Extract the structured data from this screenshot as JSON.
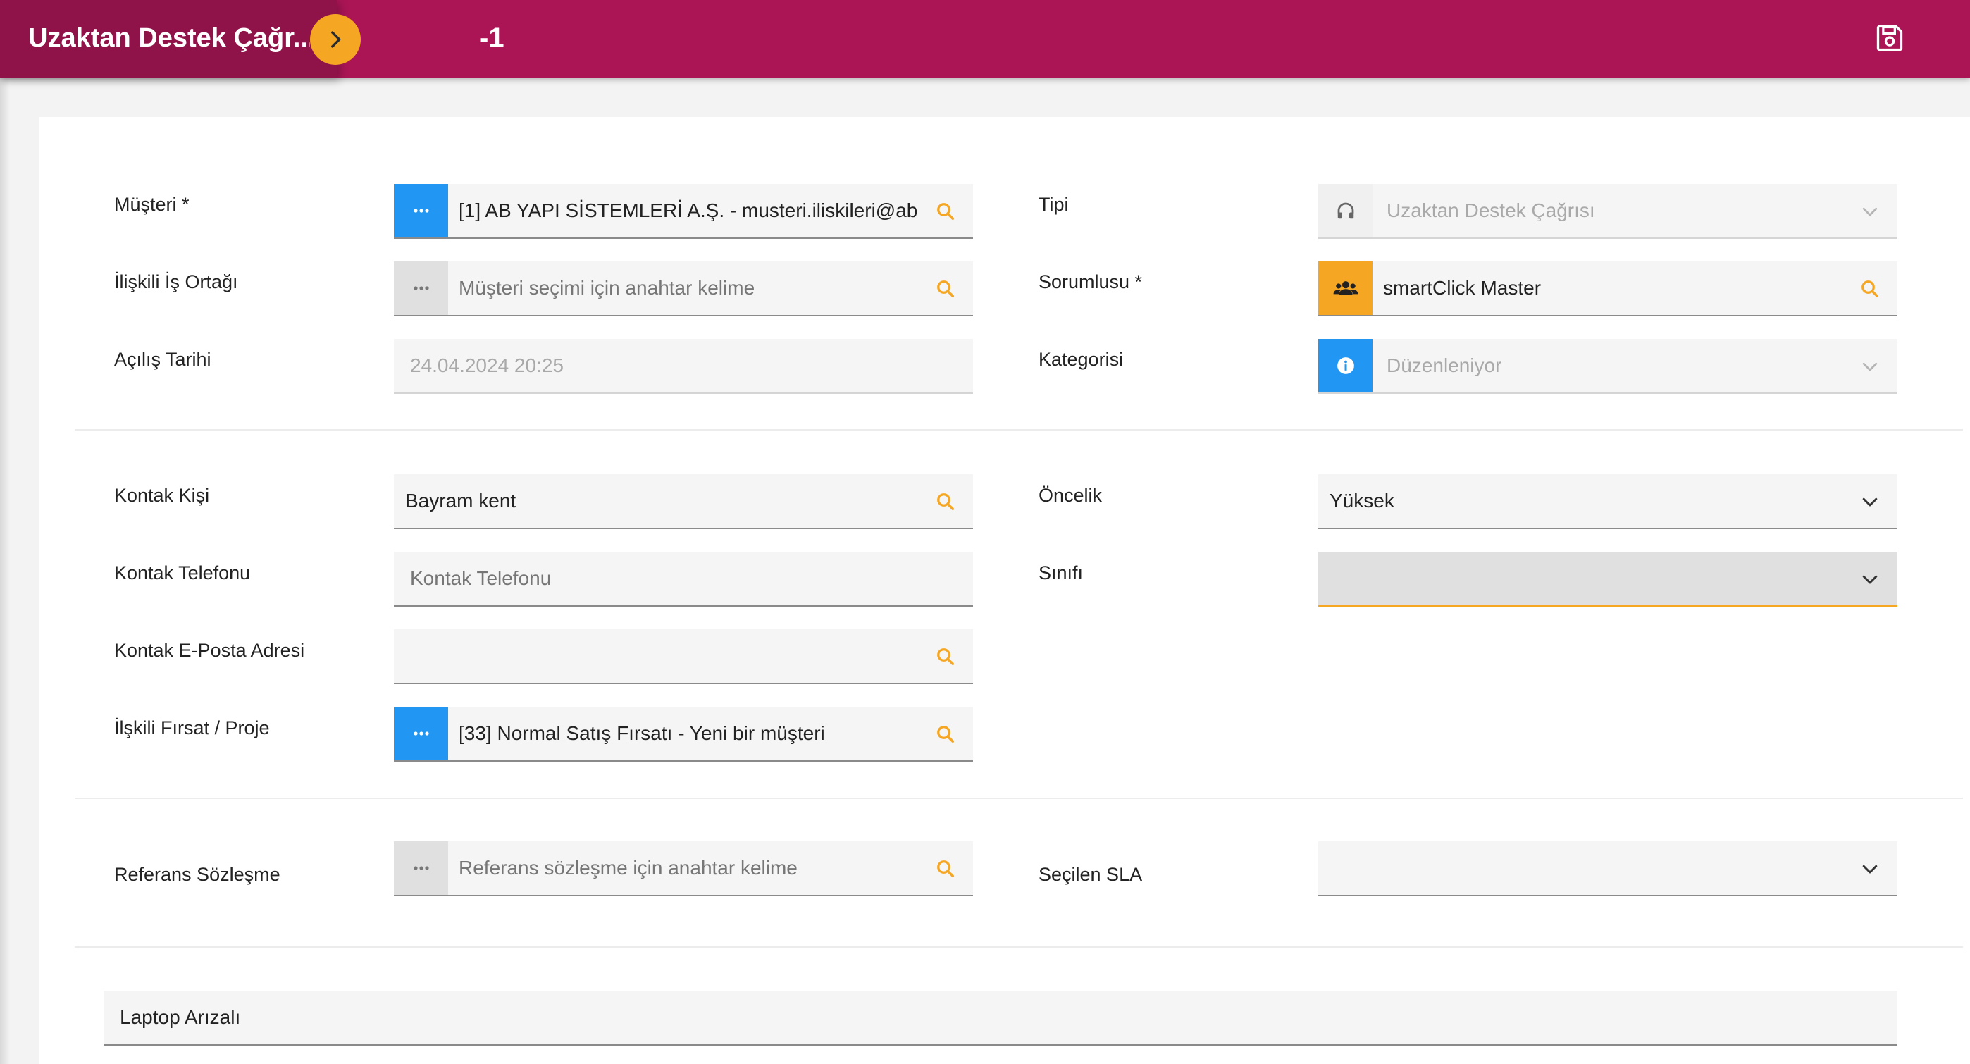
{
  "header": {
    "title": "Uzaktan Destek Çağr...",
    "record_id": "-1"
  },
  "form": {
    "musteri": {
      "label": "Müşteri  *",
      "value": "[1] AB YAPI SİSTEMLERİ A.Ş.  - musteri.iliskileri@ab"
    },
    "iliskili_is_ortagi": {
      "label": "İlişkili İş Ortağı",
      "placeholder": "Müşteri seçimi için anahtar kelime"
    },
    "acilis_tarihi": {
      "label": "Açılış Tarihi",
      "value": "24.04.2024 20:25"
    },
    "tipi": {
      "label": "Tipi",
      "value": "Uzaktan Destek Çağrısı"
    },
    "sorumlusu": {
      "label": "Sorumlusu  *",
      "value": "smartClick Master"
    },
    "kategorisi": {
      "label": "Kategorisi",
      "value": "Düzenleniyor"
    },
    "kontak_kisi": {
      "label": "Kontak Kişi",
      "value": "Bayram kent"
    },
    "kontak_telefonu": {
      "label": "Kontak Telefonu",
      "placeholder": "Kontak Telefonu"
    },
    "kontak_eposta": {
      "label": "Kontak E-Posta Adresi",
      "value": ""
    },
    "iliskili_firsat": {
      "label": "İlşkili Fırsat / Proje",
      "value": "[33] Normal Satış Fırsatı - Yeni bir müşteri"
    },
    "oncelik": {
      "label": "Öncelik",
      "value": "Yüksek"
    },
    "sinifi": {
      "label": "Sınıfı",
      "value": ""
    },
    "referans_sozlesme": {
      "label": "Referans Sözleşme",
      "placeholder": "Referans sözleşme için anahtar kelime"
    },
    "secilen_sla": {
      "label": "Seçilen SLA",
      "value": ""
    },
    "konu": {
      "value": "Laptop Arızalı"
    }
  },
  "icons": {
    "toggle": "chevron-right-icon",
    "save": "save-icon",
    "more": "more-horiz-icon",
    "search": "search-icon",
    "dropdown": "chevron-down-icon",
    "tipi_prefix": "headset-icon",
    "sorumlusu_prefix": "people-icon",
    "kategorisi_prefix": "info-icon"
  },
  "colors": {
    "header": "#ab1556",
    "header_title_box": "#8f1249",
    "accent": "#f5a623",
    "blue": "#2196f3"
  }
}
